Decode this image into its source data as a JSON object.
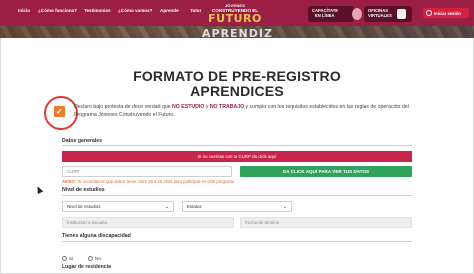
{
  "nav": {
    "links": [
      "Inicio",
      "¿Cómo funciona?",
      "Testimonios",
      "¿Cómo vamos?",
      "Aprende",
      "Tutor"
    ],
    "logo": {
      "top": "JÓVENES",
      "middle": "CONSTRUYENDO EL",
      "big": "FUTURO"
    },
    "capacitate": {
      "line1": "CAPACÍTATE",
      "line2": "EN LÍNEA"
    },
    "oficinas": {
      "line1": "OFICINAS",
      "line2": "VIRTUALES"
    },
    "login": "Iniciar sesión",
    "banner_word": "APRENDIZ"
  },
  "form": {
    "title_line1": "FORMATO DE PRE-REGISTRO",
    "title_line2": "APRENDICES",
    "declaration": {
      "part1": "Declaro bajo protesta de decir verdad que ",
      "bold1": "NO ESTUDIO",
      "part2": " y ",
      "bold2": "NO TRABAJO",
      "part3": " y cumplo con los requisitos establecidos en las reglas de operación del Programa Jóvenes Construyendo el Futuro."
    },
    "sections": {
      "datos_generales": "Datos generales",
      "nivel_estudios": "Nivel de estudios",
      "discapacidad": "Tienes alguna discapacidad",
      "residencia": "Lugar de residencia"
    },
    "curp_banner": "Si no cuentas con tu CURP da click aquí",
    "curp_placeholder": "CURP",
    "curp_button": "DA CLICK AQUÍ PARA VER TUS DATOS",
    "warning": {
      "label": "AVISO:",
      "text": " Te recordamos que debes tener entre 18 a 29 años para participar en este programa"
    },
    "nivel_select": "Nivel de estudios",
    "estatus_select": "Estatus",
    "institucion_placeholder": "Institución o escuela",
    "fecha_placeholder": "Fecha de término",
    "radio": {
      "si": "Sí",
      "no": "No"
    }
  }
}
